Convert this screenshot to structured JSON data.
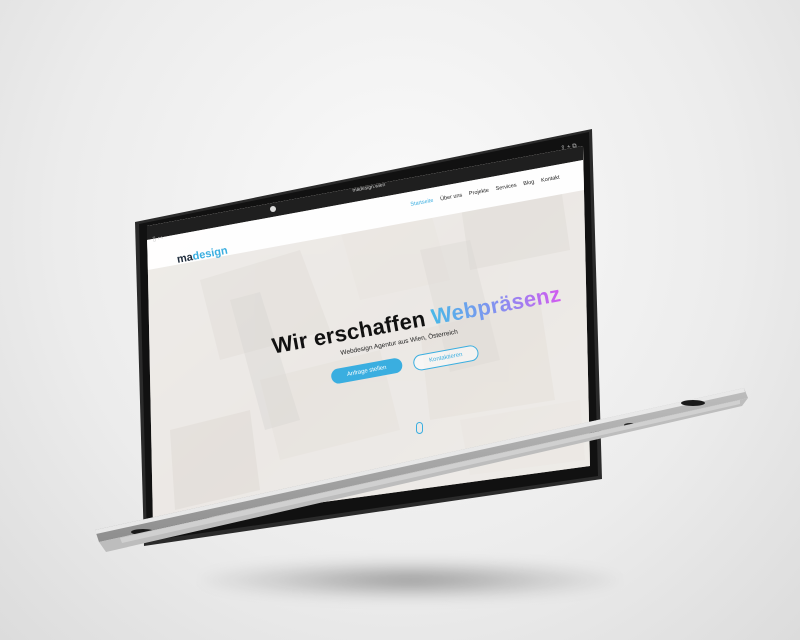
{
  "browser": {
    "url": "madesign.wien"
  },
  "site": {
    "logo_prefix": "ma",
    "logo_suffix": "design",
    "nav": [
      {
        "label": "Startseite",
        "active": true
      },
      {
        "label": "Über uns",
        "active": false
      },
      {
        "label": "Projekte",
        "active": false
      },
      {
        "label": "Services",
        "active": false
      },
      {
        "label": "Blog",
        "active": false
      },
      {
        "label": "Kontakt",
        "active": false
      }
    ],
    "hero_title_plain": "Wir erschaffen",
    "hero_title_accent": "Webpräsenz",
    "hero_subtitle": "Webdesign Agentur aus Wien, Österreich",
    "primary_button": "Anfrage stellen",
    "secondary_button": "Kontaktieren"
  },
  "colors": {
    "accent": "#3aaee0",
    "gradient_start": "#49b8e8",
    "gradient_end": "#d35bf0",
    "bezel": "#1a1a1a",
    "aluminium": "#d9d9d9"
  }
}
